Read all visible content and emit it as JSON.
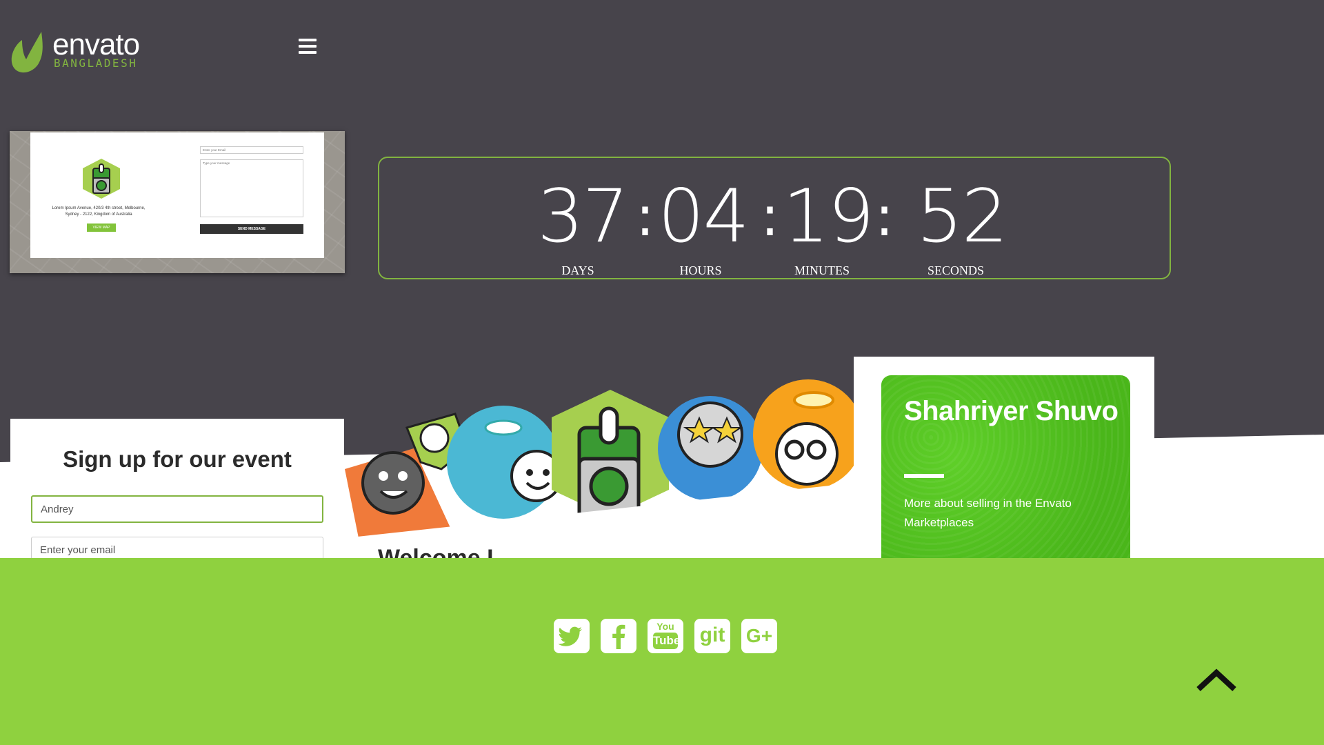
{
  "header": {
    "brand": "envato",
    "brand_sub": "BANGLADESH"
  },
  "preview": {
    "address": "Lorem Ipsum Avenue, 420/3 4th street, Melbourne, Sydney - 2122, Kingdom of Australia",
    "view_map": "VIEW MAP",
    "email_placeholder": "Enter your Email",
    "message_placeholder": "Type your message",
    "send_label": "SEND MESSAGE"
  },
  "countdown": {
    "days": "37",
    "hours": "04",
    "minutes": "19",
    "seconds": "52",
    "separator": ":",
    "days_label": "DAYS",
    "hours_label": "HOURS",
    "minutes_label": "MINUTES",
    "seconds_label": "SECONDS"
  },
  "signup": {
    "title": "Sign up for our event",
    "name_value": "Andrey",
    "email_placeholder": "Enter your email"
  },
  "welcome": {
    "heading": "Welcome I"
  },
  "profile": {
    "name": "Shahriyer Shuvo",
    "description": "More about selling in the Envato Marketplaces"
  },
  "footer": {
    "social": [
      "twitter-icon",
      "facebook-icon",
      "youtube-icon",
      "github-icon",
      "google-plus-icon"
    ],
    "youtube_label_top": "You",
    "youtube_label_bottom": "Tube",
    "github_label": "git",
    "google_label": "G+"
  },
  "colors": {
    "background": "#47444b",
    "accent": "#82b440",
    "footer": "#8fd13f",
    "profile_card": "#4ab61a"
  }
}
